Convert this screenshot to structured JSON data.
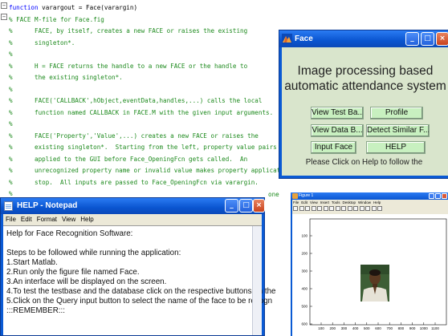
{
  "editor": {
    "lines": [
      {
        "type": "keyword",
        "keyword": "function",
        "text": " varargout = Face(varargin)"
      },
      {
        "type": "comment",
        "text": "% FACE M-file for Face.fig"
      },
      {
        "type": "comment",
        "text": "%      FACE, by itself, creates a new FACE or raises the existing"
      },
      {
        "type": "comment",
        "text": "%      singleton*."
      },
      {
        "type": "comment",
        "text": "%"
      },
      {
        "type": "comment",
        "text": "%      H = FACE returns the handle to a new FACE or the handle to"
      },
      {
        "type": "comment",
        "text": "%      the existing singleton*."
      },
      {
        "type": "comment",
        "text": "%"
      },
      {
        "type": "comment",
        "text": "%      FACE('CALLBACK',hObject,eventData,handles,...) calls the local"
      },
      {
        "type": "comment",
        "text": "%      function named CALLBACK in FACE.M with the given input arguments."
      },
      {
        "type": "comment",
        "text": "%"
      },
      {
        "type": "comment",
        "text": "%      FACE('Property','Value',...) creates a new FACE or raises the"
      },
      {
        "type": "comment",
        "text": "%      existing singleton*.  Starting from the left, property value pairs are"
      },
      {
        "type": "comment",
        "text": "%      applied to the GUI before Face_OpeningFcn gets called.  An"
      },
      {
        "type": "comment",
        "text": "%      unrecognized property name or invalid value makes property application"
      },
      {
        "type": "comment",
        "text": "%      stop.  All inputs are passed to Face_OpeningFcn via varargin."
      },
      {
        "type": "comment",
        "text": "%"
      }
    ],
    "trailing_text": "one"
  },
  "face_window": {
    "title": "Face",
    "heading_line1": "Image processing based",
    "heading_line2": "automatic attendance system",
    "buttons": {
      "view_test": "View Test Ba...",
      "profile": "Profile",
      "view_data": "View Data B...",
      "detect_similar": "Detect Similar F...",
      "input_face": "Input Face",
      "help": "HELP"
    },
    "help_text": "Please Click on Help to follow the",
    "colors": {
      "body": "#d9e5cc",
      "button": "#c8f0c0",
      "titlebar": "#0a55d0"
    }
  },
  "notepad": {
    "title": "HELP - Notepad",
    "menu": [
      "File",
      "Edit",
      "Format",
      "View",
      "Help"
    ],
    "lines": [
      "Help for Face Recognition Software:",
      "",
      "Steps to be followed while running the application:",
      "1.Start Matlab.",
      "2.Run only the figure file named Face.",
      "3.An interface will be displayed on the screen.",
      "4.To test the testbase and the database click on the respective buttons on the",
      "5.Click on the Query input button to select the name of the face to be recogn",
      ":::REMEMBER:::"
    ]
  },
  "figure_window": {
    "title": "Figure 1",
    "menu": [
      "File",
      "Edit",
      "View",
      "Insert",
      "Tools",
      "Desktop",
      "Window",
      "Help"
    ],
    "y_ticks": [
      "100",
      "200",
      "300",
      "400",
      "500",
      "600"
    ],
    "x_ticks": [
      "100",
      "200",
      "300",
      "400",
      "500",
      "600",
      "700",
      "800",
      "900",
      "1000",
      "1100"
    ]
  }
}
